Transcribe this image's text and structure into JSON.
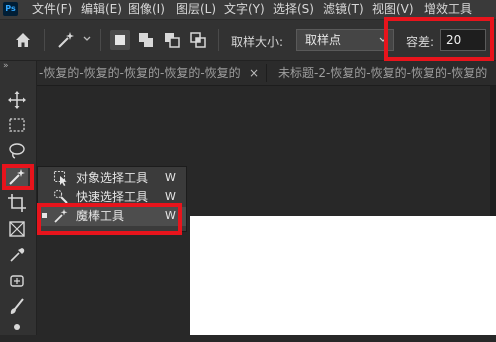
{
  "app": {
    "logo": "Ps"
  },
  "menu": [
    "文件(F)",
    "编辑(E)",
    "图像(I)",
    "图层(L)",
    "文字(Y)",
    "选择(S)",
    "滤镜(T)",
    "视图(V)",
    "增效工具"
  ],
  "options": {
    "sample_size_label": "取样大小:",
    "sample_size_value": "取样点",
    "tolerance_label": "容差:",
    "tolerance_value": "20"
  },
  "tabs": [
    {
      "label": "-恢复的-恢复的-恢复的-恢复的-恢复的"
    },
    {
      "label": "未标题-2-恢复的-恢复的-恢复的-恢复的"
    }
  ],
  "tab_close": "×",
  "toolbar_collapse": "»",
  "flyout": [
    {
      "icon": "object-select-icon",
      "label": "对象选择工具",
      "key": "W",
      "selected": false
    },
    {
      "icon": "quick-select-icon",
      "label": "快速选择工具",
      "key": "W",
      "selected": false
    },
    {
      "icon": "magic-wand-icon",
      "label": "魔棒工具",
      "key": "W",
      "selected": true
    }
  ],
  "colors": {
    "highlight": "#e8141c",
    "menubar": "#3a3a3a",
    "optionsbar": "#323232",
    "workspace": "#282828"
  }
}
